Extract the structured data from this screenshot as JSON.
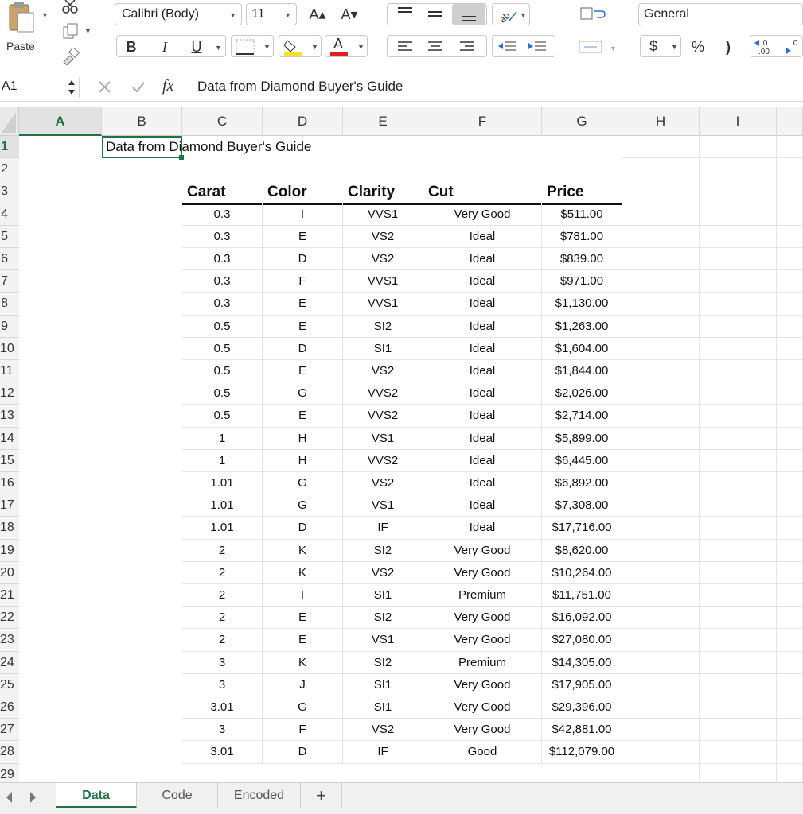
{
  "ribbon": {
    "paste_label": "Paste",
    "font_name": "Calibri (Body)",
    "font_size": "11",
    "number_format": "General",
    "bold": "B",
    "italic": "I",
    "underline": "U",
    "grow_font": "A▴",
    "shrink_font": "A▾",
    "currency": "$",
    "percent": "%",
    "comma": ")",
    "inc_decimal": "←.0\n.00",
    "dec_decimal": ".0"
  },
  "formula_bar": {
    "name_box": "A1",
    "fx": "fx",
    "content": "Data from Diamond Buyer's Guide"
  },
  "columns": [
    "A",
    "B",
    "C",
    "D",
    "E",
    "F",
    "G",
    "H",
    "I"
  ],
  "row_numbers": [
    "1",
    "2",
    "3",
    "4",
    "5",
    "6",
    "7",
    "8",
    "9",
    "10",
    "11",
    "12",
    "13",
    "14",
    "15",
    "16",
    "17",
    "18",
    "19",
    "20",
    "21",
    "22",
    "23",
    "24",
    "25",
    "26",
    "27",
    "28",
    "29"
  ],
  "sheet": {
    "a1": "Data from Diamond Buyer's Guide",
    "headers": [
      "Carat",
      "Color",
      "Clarity",
      "Cut",
      "Price"
    ],
    "rows": [
      [
        "0.3",
        "I",
        "VVS1",
        "Very Good",
        "$511.00"
      ],
      [
        "0.3",
        "E",
        "VS2",
        "Ideal",
        "$781.00"
      ],
      [
        "0.3",
        "D",
        "VS2",
        "Ideal",
        "$839.00"
      ],
      [
        "0.3",
        "F",
        "VVS1",
        "Ideal",
        "$971.00"
      ],
      [
        "0.3",
        "E",
        "VVS1",
        "Ideal",
        "$1,130.00"
      ],
      [
        "0.5",
        "E",
        "SI2",
        "Ideal",
        "$1,263.00"
      ],
      [
        "0.5",
        "D",
        "SI1",
        "Ideal",
        "$1,604.00"
      ],
      [
        "0.5",
        "E",
        "VS2",
        "Ideal",
        "$1,844.00"
      ],
      [
        "0.5",
        "G",
        "VVS2",
        "Ideal",
        "$2,026.00"
      ],
      [
        "0.5",
        "E",
        "VVS2",
        "Ideal",
        "$2,714.00"
      ],
      [
        "1",
        "H",
        "VS1",
        "Ideal",
        "$5,899.00"
      ],
      [
        "1",
        "H",
        "VVS2",
        "Ideal",
        "$6,445.00"
      ],
      [
        "1.01",
        "G",
        "VS2",
        "Ideal",
        "$6,892.00"
      ],
      [
        "1.01",
        "G",
        "VS1",
        "Ideal",
        "$7,308.00"
      ],
      [
        "1.01",
        "D",
        "IF",
        "Ideal",
        "$17,716.00"
      ],
      [
        "2",
        "K",
        "SI2",
        "Very Good",
        "$8,620.00"
      ],
      [
        "2",
        "K",
        "VS2",
        "Very Good",
        "$10,264.00"
      ],
      [
        "2",
        "I",
        "SI1",
        "Premium",
        "$11,751.00"
      ],
      [
        "2",
        "E",
        "SI2",
        "Very Good",
        "$16,092.00"
      ],
      [
        "2",
        "E",
        "VS1",
        "Very Good",
        "$27,080.00"
      ],
      [
        "3",
        "K",
        "SI2",
        "Premium",
        "$14,305.00"
      ],
      [
        "3",
        "J",
        "SI1",
        "Very Good",
        "$17,905.00"
      ],
      [
        "3.01",
        "G",
        "SI1",
        "Very Good",
        "$29,396.00"
      ],
      [
        "3",
        "F",
        "VS2",
        "Very Good",
        "$42,881.00"
      ],
      [
        "3.01",
        "D",
        "IF",
        "Good",
        "$112,079.00"
      ]
    ]
  },
  "tabs": [
    "Data",
    "Code",
    "Encoded"
  ],
  "add_tab": "+",
  "colors": {
    "accent": "#217346",
    "font_color_bar": "#e0201a",
    "fill_color_bar": "#f5e51c"
  }
}
